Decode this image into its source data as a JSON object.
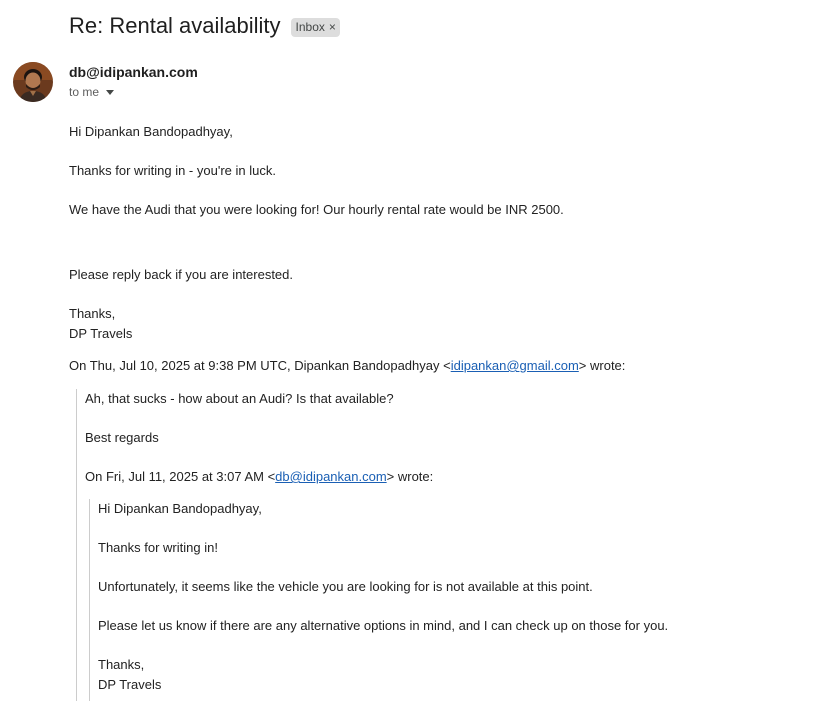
{
  "email": {
    "subject": "Re: Rental availability",
    "label": "Inbox",
    "label_remove": "×",
    "sender": "db@idipankan.com",
    "recipient": "to me"
  },
  "message": {
    "greeting": "Hi Dipankan Bandopadhyay,",
    "line1": "Thanks for writing in - you're in luck.",
    "line2": "We have the Audi that you were looking for! Our hourly rental rate would be INR 2500.",
    "line3": "Please reply back if you are interested.",
    "signoff": "Thanks,",
    "signature": "DP Travels"
  },
  "quote1": {
    "attribution_prefix": "On Thu, Jul 10, 2025 at 9:38 PM UTC, Dipankan Bandopadhyay <",
    "attribution_email": "idipankan@gmail.com",
    "attribution_suffix": "> wrote:",
    "line1": "Ah, that sucks - how about an Audi? Is that available?",
    "signoff": "Best regards"
  },
  "quote2": {
    "attribution_prefix": "On Fri, Jul 11, 2025 at 3:07 AM <",
    "attribution_email": "db@idipankan.com",
    "attribution_suffix": "> wrote:",
    "greeting": "Hi Dipankan Bandopadhyay,",
    "line1": "Thanks for writing in!",
    "line2": "Unfortunately, it seems like the vehicle you are looking for is not available at this point.",
    "line3": "Please let us know if there are any alternative options in mind, and I can check up on those for you.",
    "signoff": "Thanks,",
    "signature": "DP Travels"
  },
  "colors": {
    "link": "#1a5fb4",
    "label_chip_bg": "#dddddd",
    "quote_bar": "#cccccc"
  }
}
